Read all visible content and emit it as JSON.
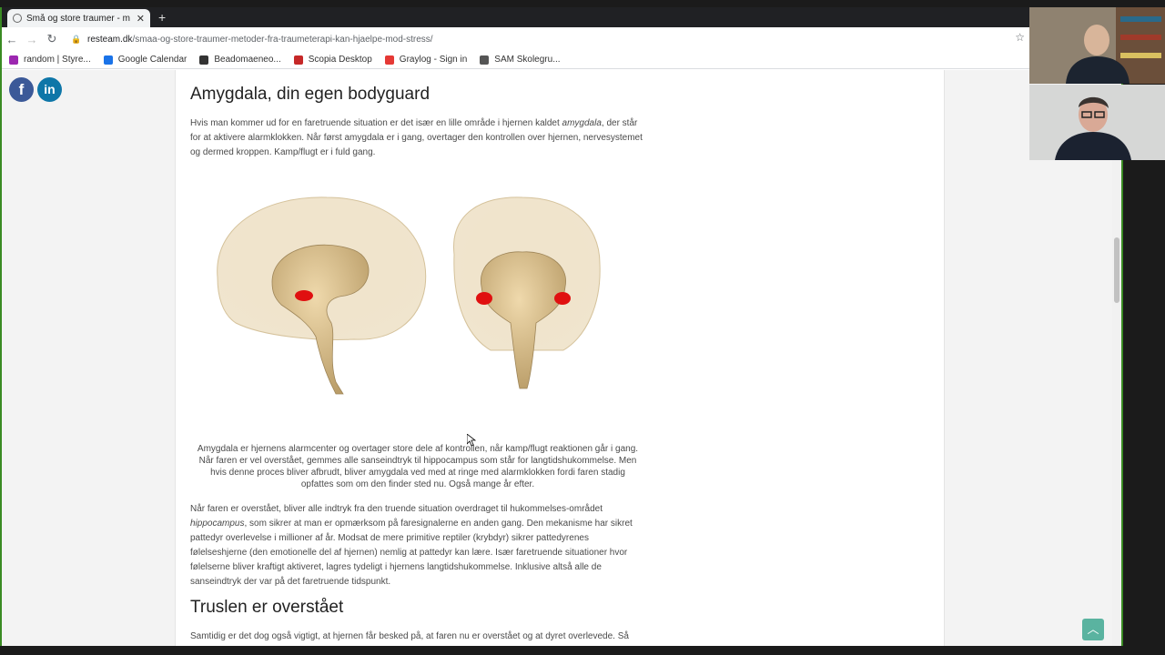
{
  "browser": {
    "tab_title": "Små og store traumer - m",
    "url_host": "resteam.dk",
    "url_path": "/smaa-og-store-traumer-metoder-fra-traumeterapi-kan-hjaelpe-mod-stress/",
    "bookmarks": [
      {
        "label": "random | Styre...",
        "icon_color": "#9c27b0"
      },
      {
        "label": "Google Calendar",
        "icon_color": "#1a73e8"
      },
      {
        "label": "Beadomaeneo...",
        "icon_color": "#333333"
      },
      {
        "label": "Scopia Desktop",
        "icon_color": "#c62828"
      },
      {
        "label": "Graylog - Sign in",
        "icon_color": "#e53935"
      },
      {
        "label": "SAM Skolegru...",
        "icon_color": "#555555"
      }
    ]
  },
  "social": {
    "facebook": "f",
    "linkedin": "in"
  },
  "article": {
    "heading1": "Amygdala, din egen bodyguard",
    "p1_before": "Hvis man kommer ud for en faretruende situation er det især en lille område i hjernen kaldet ",
    "p1_em": "amygdala",
    "p1_after": ", der står for at aktivere alarmklokken. Når først amygdala er i gang, overtager den kontrollen over hjernen, nervesystemet og dermed kroppen. Kamp/flugt er i fuld gang.",
    "caption": "Amygdala er hjernens alarmcenter og overtager store dele af kontrollen, når kamp/flugt reaktionen går i gang. Når faren er vel overstået, gemmes alle sanseindtryk til hippocampus som står for langtidshukommelse. Men hvis denne proces bliver afbrudt, bliver amygdala ved med at ringe med alarmklokken fordi faren stadig opfattes som om den finder sted nu. Også mange år efter.",
    "p2_before": "Når faren er overstået, bliver alle indtryk fra den truende situation overdraget til hukommelses-området ",
    "p2_em": "hippocampus",
    "p2_after": ", som sikrer at man er opmærksom på faresignalerne en anden gang. Den mekanisme har sikret pattedyr overlevelse i millioner af år. Modsat de mere primitive reptiler (krybdyr) sikrer pattedyrenes følelseshjerne (den emotionelle del af hjernen) nemlig at pattedyr kan lære. Især faretruende situationer hvor følelserne bliver kraftigt aktiveret, lagres tydeligt i hjernens langtidshukommelse. Inklusive altså alle de sanseindtryk der var på det faretruende tidspunkt.",
    "heading2": "Truslen er overstået",
    "p3": "Samtidig er det dog også vigtigt, at hjernen får besked på, at faren nu er overstået og at dyret overlevede. Så kan nervesystemet bremse op og finde tilbage til normalen."
  },
  "colors": {
    "accent": "#5ab3a0",
    "brain": "#d9c49a",
    "amygdala": "#e01010"
  }
}
